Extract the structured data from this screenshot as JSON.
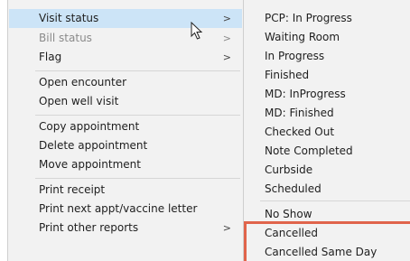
{
  "menu": {
    "items": [
      {
        "label": "Visit status",
        "submenu": true,
        "highlighted": true,
        "disabled": false
      },
      {
        "label": "Bill status",
        "submenu": true,
        "highlighted": false,
        "disabled": true
      },
      {
        "label": "Flag",
        "submenu": true,
        "highlighted": false,
        "disabled": false
      },
      {
        "label": "Open encounter",
        "submenu": false,
        "highlighted": false,
        "disabled": false
      },
      {
        "label": "Open well visit",
        "submenu": false,
        "highlighted": false,
        "disabled": false
      },
      {
        "label": "Copy appointment",
        "submenu": false,
        "highlighted": false,
        "disabled": false
      },
      {
        "label": "Delete appointment",
        "submenu": false,
        "highlighted": false,
        "disabled": false
      },
      {
        "label": "Move appointment",
        "submenu": false,
        "highlighted": false,
        "disabled": false
      },
      {
        "label": "Print receipt",
        "submenu": false,
        "highlighted": false,
        "disabled": false
      },
      {
        "label": "Print next appt/vaccine letter",
        "submenu": false,
        "highlighted": false,
        "disabled": false
      },
      {
        "label": "Print other reports",
        "submenu": true,
        "highlighted": false,
        "disabled": false
      }
    ],
    "chevron_glyph": ">"
  },
  "submenu": {
    "items": [
      "PCP: In Progress",
      "Waiting Room",
      "In Progress",
      "Finished",
      "MD: InProgress",
      "MD: Finished",
      "Checked Out",
      "Note Completed",
      "Curbside",
      "Scheduled",
      "No Show",
      "Cancelled",
      "Cancelled Same Day"
    ],
    "boxed_items": [
      "Cancelled",
      "Cancelled Same Day"
    ]
  },
  "colors": {
    "menu_background": "#f2f2f2",
    "highlight_background": "#cce4f7",
    "callout_border": "#e0644b",
    "disabled_text": "#8a8a8a"
  },
  "icons": {
    "cursor": "mouse-pointer-icon",
    "submenu_arrow": "chevron-right-icon"
  }
}
